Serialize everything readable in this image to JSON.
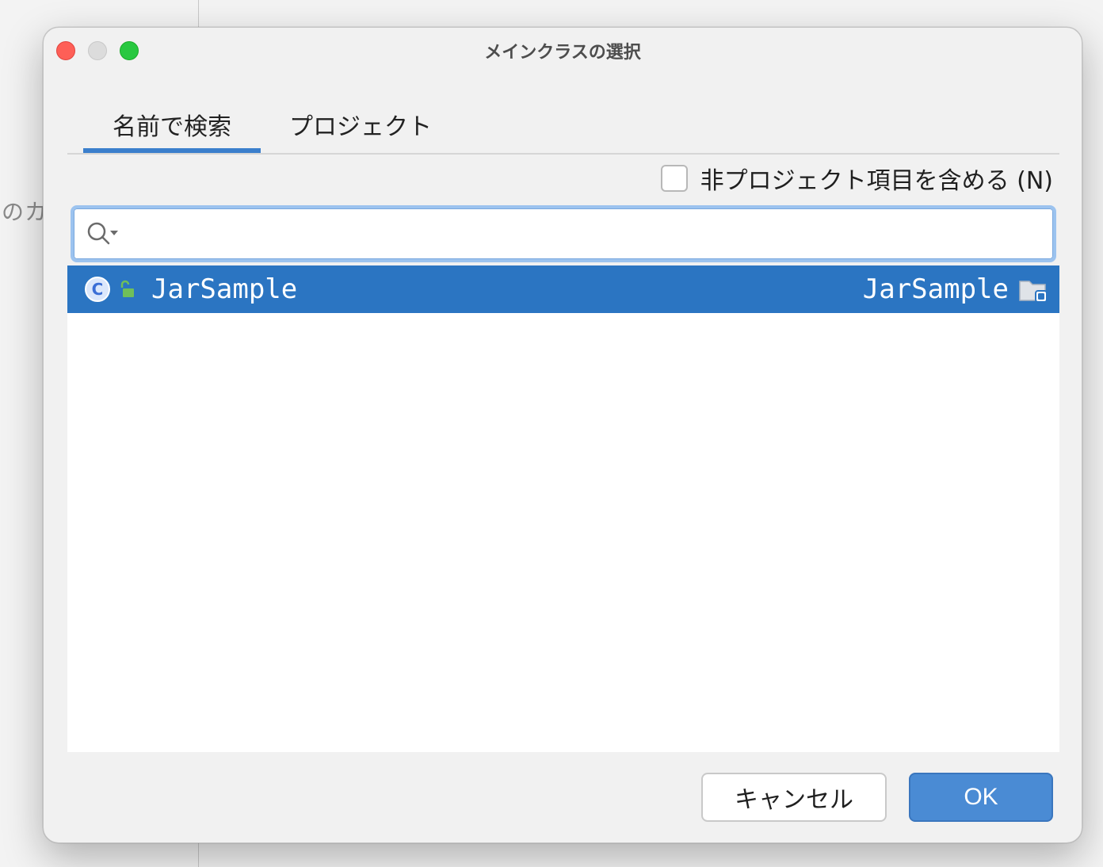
{
  "background": {
    "partial_text": "のカ"
  },
  "dialog": {
    "title": "メインクラスの選択",
    "tabs": [
      {
        "label": "名前で検索",
        "active": true
      },
      {
        "label": "プロジェクト",
        "active": false
      }
    ],
    "include_non_project": {
      "label": "非プロジェクト項目を含める (N)",
      "checked": false
    },
    "search": {
      "value": "",
      "placeholder": ""
    },
    "results": [
      {
        "name": "JarSample",
        "module": "JarSample",
        "icon": "class-icon",
        "selected": true
      }
    ],
    "buttons": {
      "cancel": "キャンセル",
      "ok": "OK"
    }
  },
  "colors": {
    "accent": "#3b7fcc",
    "selection": "#2b75c2",
    "ok_button": "#4a8bd4"
  }
}
